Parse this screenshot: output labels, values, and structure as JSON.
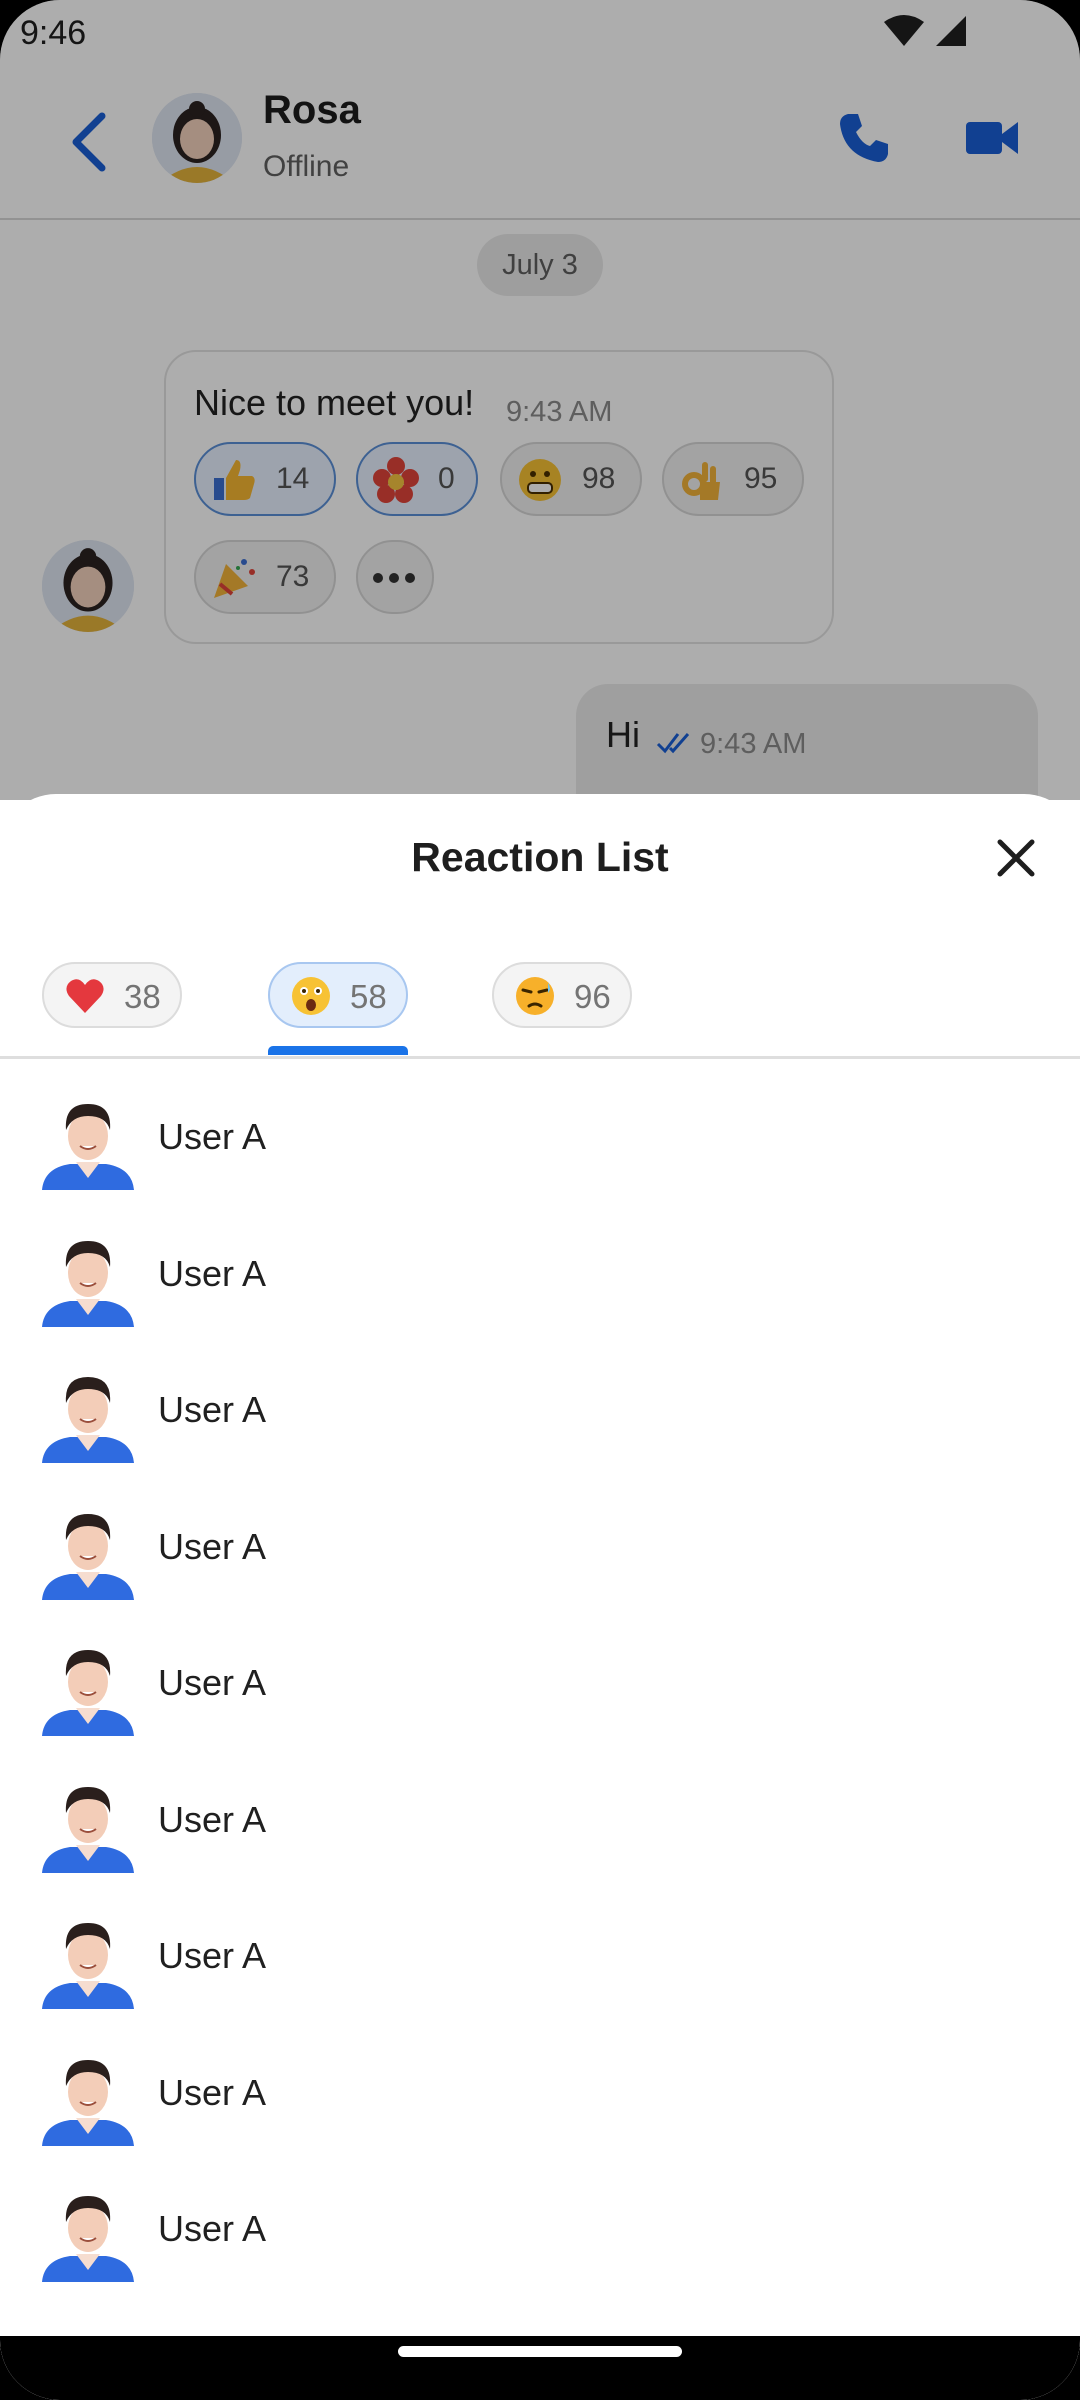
{
  "status_bar": {
    "time": "9:46"
  },
  "header": {
    "contact_name": "Rosa",
    "contact_status": "Offline"
  },
  "chat": {
    "date_chip": "July 3",
    "incoming": {
      "text": "Nice to meet you!",
      "time": "9:43 AM",
      "reactions": [
        {
          "icon": "thumbs-up-icon",
          "count": "14",
          "selected": true
        },
        {
          "icon": "flower-icon",
          "count": "0",
          "selected": true
        },
        {
          "icon": "grimace-icon",
          "count": "98",
          "selected": false
        },
        {
          "icon": "ok-hand-icon",
          "count": "95",
          "selected": false
        },
        {
          "icon": "party-popper-icon",
          "count": "73",
          "selected": false
        }
      ]
    },
    "outgoing": {
      "text": "Hi",
      "time": "9:43 AM"
    }
  },
  "sheet": {
    "title": "Reaction List",
    "tabs": [
      {
        "icon": "red-heart-icon",
        "count": "38",
        "active": false
      },
      {
        "icon": "astonished-face-icon",
        "count": "58",
        "active": true
      },
      {
        "icon": "unamused-face-icon",
        "count": "96",
        "active": false
      }
    ],
    "users": [
      {
        "name": "User A"
      },
      {
        "name": "User A"
      },
      {
        "name": "User A"
      },
      {
        "name": "User A"
      },
      {
        "name": "User A"
      },
      {
        "name": "User A"
      },
      {
        "name": "User A"
      },
      {
        "name": "User A"
      },
      {
        "name": "User A"
      }
    ]
  },
  "colors": {
    "accent": "#1a73e8",
    "scrim": "#000000"
  }
}
